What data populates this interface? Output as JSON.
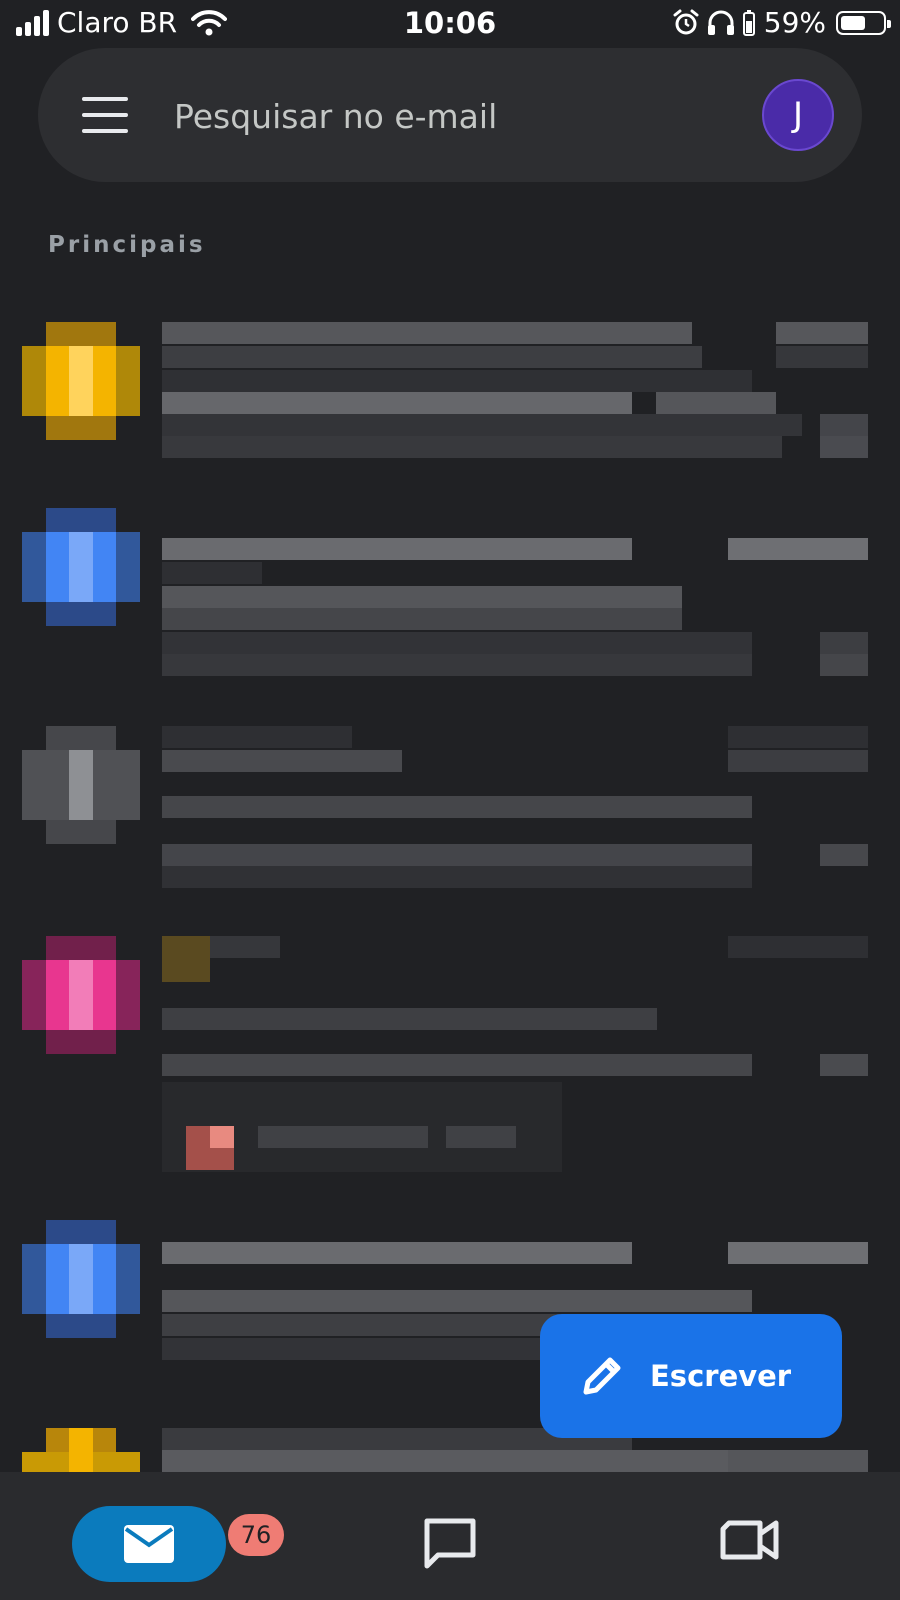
{
  "status_bar": {
    "carrier": "Claro BR",
    "time": "10:06",
    "battery_percent": "59%",
    "battery_level": 0.59,
    "icons": [
      "signal-icon",
      "wifi-icon",
      "alarm-icon",
      "headphones-icon",
      "battery-icon"
    ]
  },
  "search": {
    "placeholder": "Pesquisar no e-mail",
    "menu_icon": "menu-icon",
    "avatar_initial": "J",
    "avatar_color": "#4a2ba8"
  },
  "inbox": {
    "section_label": "Principais",
    "avatar_colors": [
      "#f4b400",
      "#4285f4",
      "#9aa0a6",
      "#e8368f",
      "#4285f4",
      "#f4b400"
    ]
  },
  "fab": {
    "label": "Escrever",
    "icon": "pencil-icon",
    "color": "#1a73e8"
  },
  "bottom_nav": {
    "mail_badge": "76",
    "items": [
      "mail-icon",
      "chat-icon",
      "meet-icon"
    ],
    "accent": "#0b7bbd"
  }
}
